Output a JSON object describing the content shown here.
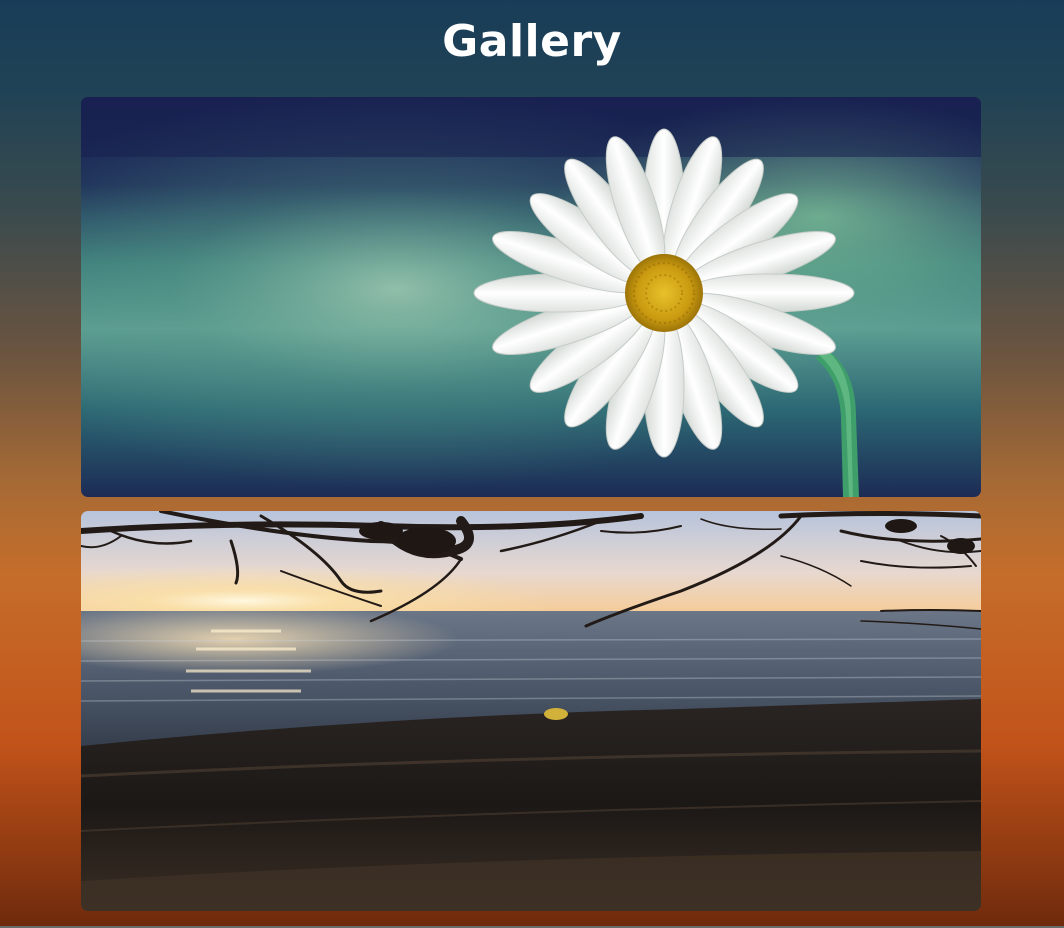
{
  "page": {
    "title": "Gallery"
  },
  "gallery": {
    "images": [
      {
        "subject": "daisy-flower",
        "colors": {
          "primary": "#1a2b55",
          "accent": "#6fb897"
        }
      },
      {
        "subject": "ocean-sunset",
        "colors": {
          "primary": "#b9c8de",
          "accent": "#f6d08c"
        }
      }
    ]
  }
}
